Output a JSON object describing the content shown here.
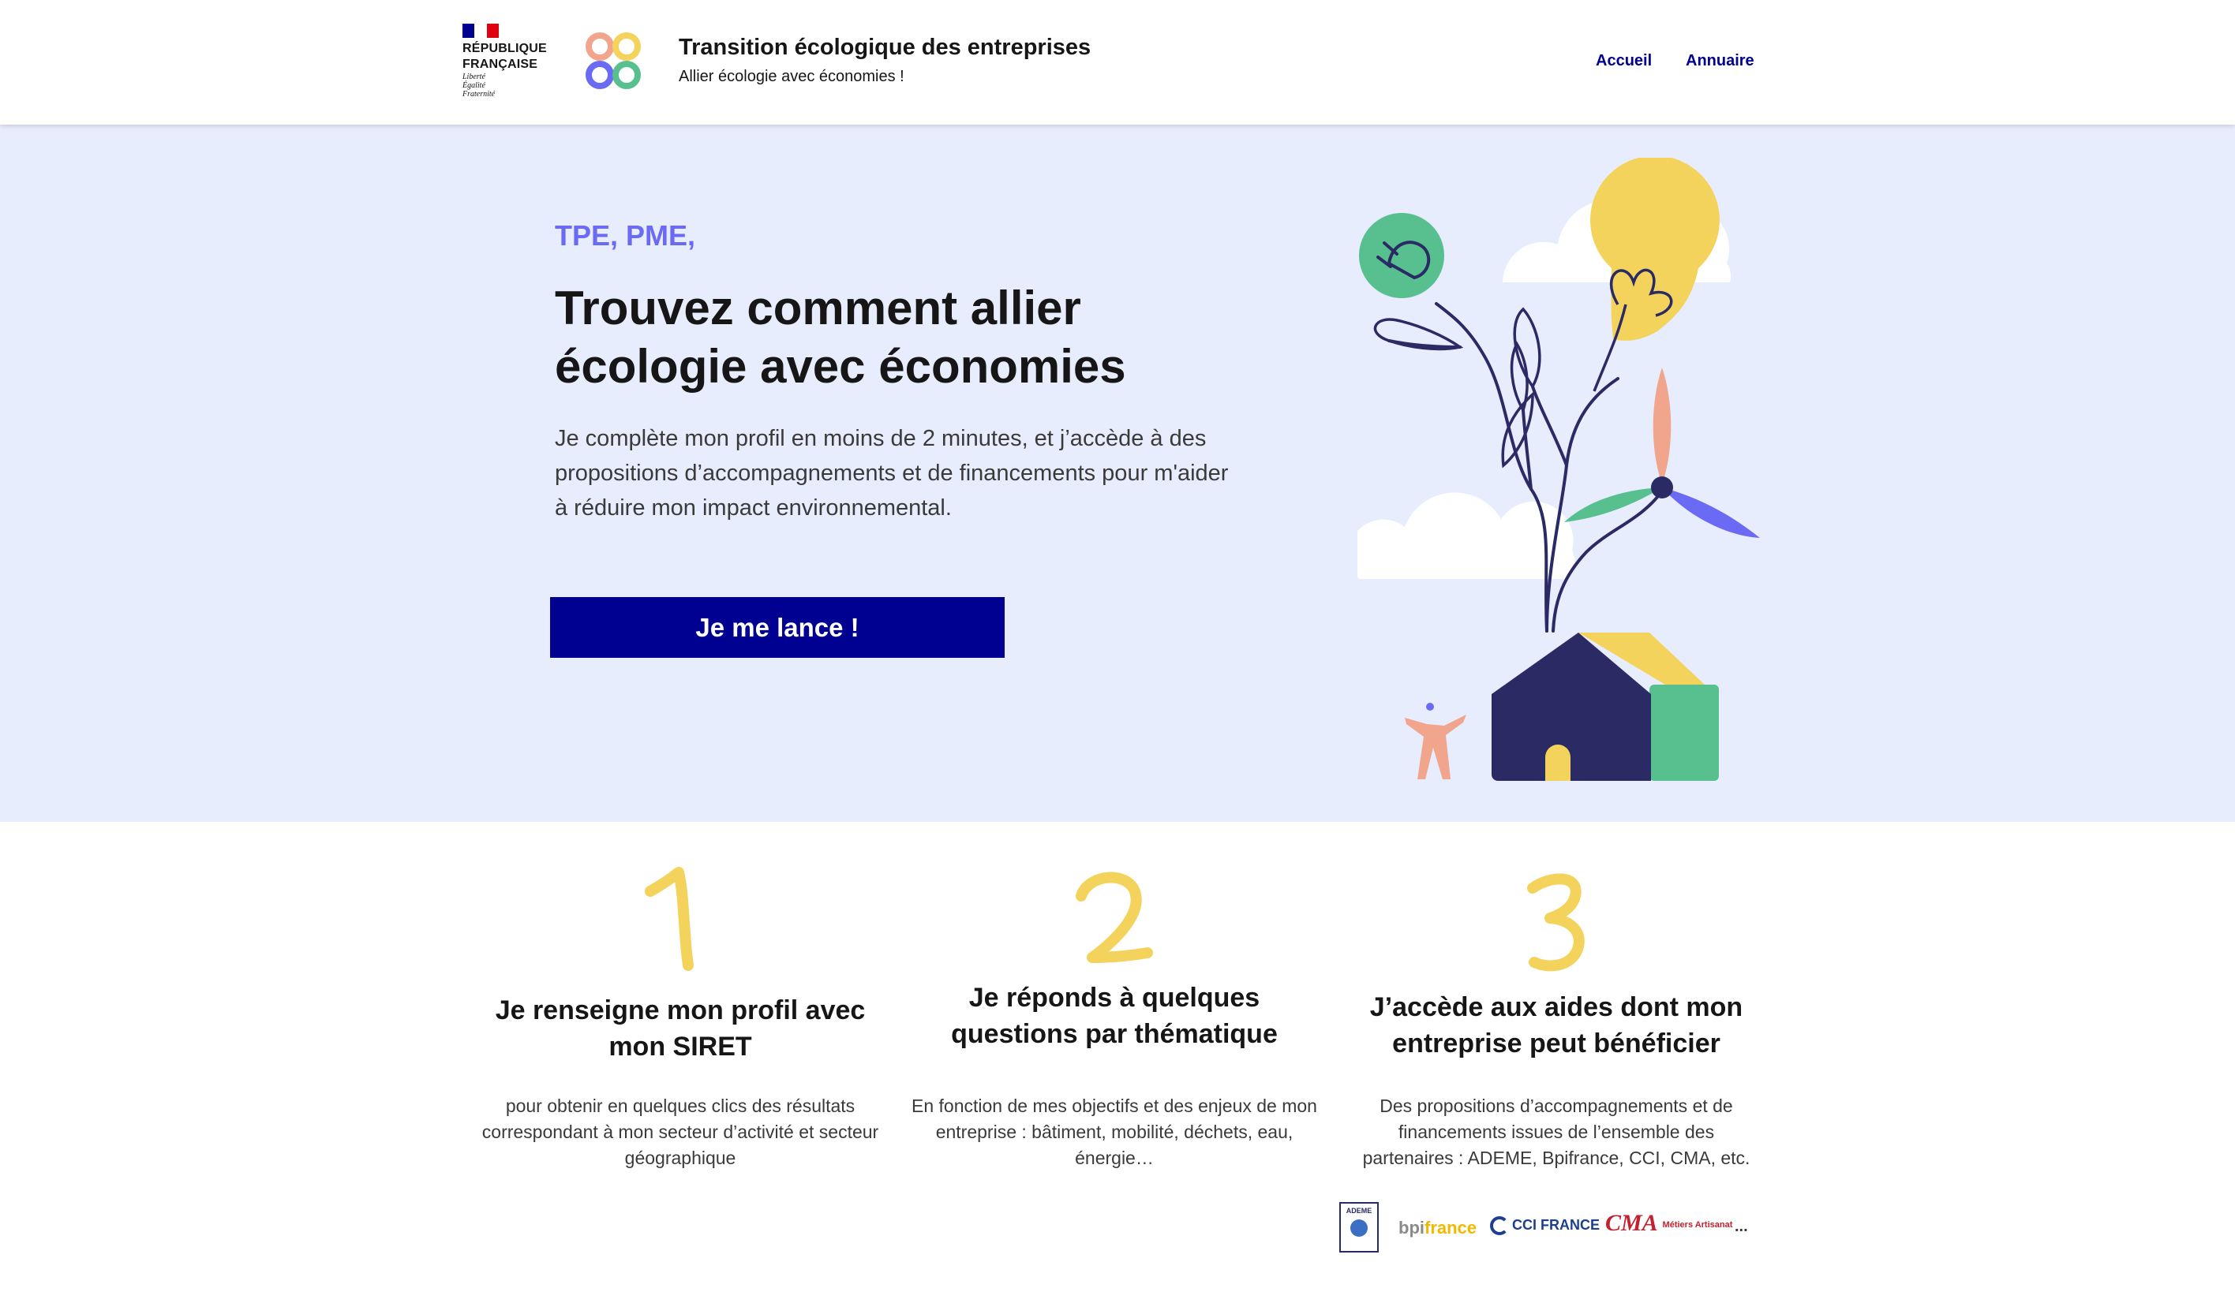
{
  "header": {
    "gov_name_line1": "RÉPUBLIQUE",
    "gov_name_line2": "FRANÇAISE",
    "motto_1": "Liberté",
    "motto_2": "Égalité",
    "motto_3": "Fraternité",
    "app_title": "Transition écologique des entreprises",
    "app_subtitle": "Allier écologie avec économies !",
    "nav": {
      "home": "Accueil",
      "directory": "Annuaire"
    }
  },
  "hero": {
    "kicker": "TPE, PME,",
    "title": "Trouvez comment allier écologie avec économies",
    "description": "Je complète mon profil en moins de 2 minutes, et j’accède à des propositions d’accompagnements et de financements pour m'aider à réduire mon impact environnemental.",
    "cta_label": "Je me lance !"
  },
  "steps": [
    {
      "number": "1",
      "title": "Je renseigne mon profil avec mon SIRET",
      "text": "pour obtenir en quelques clics des résultats correspondant à mon secteur d’activité et secteur géographique"
    },
    {
      "number": "2",
      "title": "Je réponds à quelques questions par thématique",
      "text": "En fonction de mes objectifs et des enjeux de mon entreprise : bâtiment, mobilité, déchets, eau, énergie…"
    },
    {
      "number": "3",
      "title": "J’accède aux aides dont mon entreprise peut bénéficier",
      "text": "Des propositions d’accompagnements et de financements issues de l’ensemble des partenaires : ADEME, Bpifrance, CCI, CMA, etc."
    }
  ],
  "partners": {
    "ademe": "ADEME",
    "bpi_a": "bpi",
    "bpi_b": "france",
    "cci": "CCI FRANCE",
    "cma": "CMA",
    "cma_tag": "Métiers Artisanat",
    "more": "..."
  },
  "colors": {
    "blue_france": "#000091",
    "hero_bg": "#e8edfd",
    "kicker": "#6a6af4",
    "number_yellow": "#f3d35c",
    "marianne_red": "#e1000f"
  }
}
